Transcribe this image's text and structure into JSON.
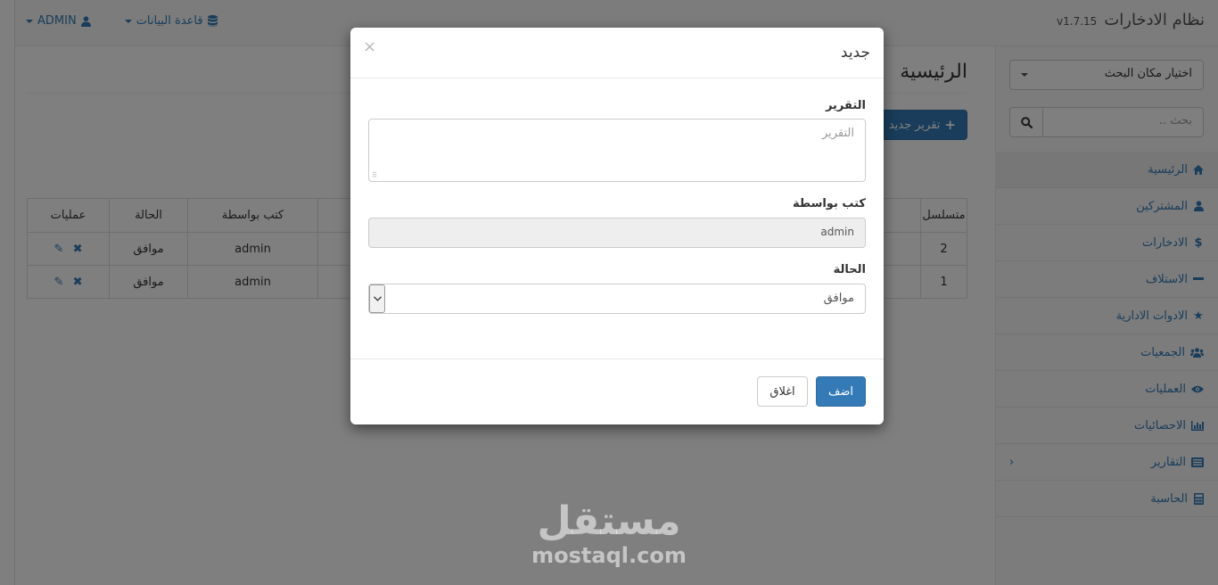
{
  "navbar": {
    "brand": "نظام الادخارات",
    "version": "v1.7.15",
    "database_label": "قاعدة البيانات",
    "user_label": "ADMIN"
  },
  "sidebar": {
    "location_select": "اختيار مكان البحث",
    "search_placeholder": "بحث ..",
    "items": [
      {
        "label": "الرئيسية",
        "icon": "home-icon"
      },
      {
        "label": "المشتركين",
        "icon": "user-icon"
      },
      {
        "label": "الادخارات",
        "icon": "dollar-icon"
      },
      {
        "label": "الاستلاف",
        "icon": "minus-icon"
      },
      {
        "label": "الادوات الادارية",
        "icon": "star-icon"
      },
      {
        "label": "الجمعيات",
        "icon": "users-icon"
      },
      {
        "label": "العمليات",
        "icon": "eye-icon"
      },
      {
        "label": "الاحصائيات",
        "icon": "bar-chart-icon"
      },
      {
        "label": "التقارير",
        "icon": "list-icon"
      },
      {
        "label": "الحاسبة",
        "icon": "calculator-icon"
      }
    ]
  },
  "main": {
    "title": "الرئيسية",
    "new_report_button": "تقرير جديد",
    "table": {
      "headers": [
        "متسلسل",
        "",
        "كتب بواسطة",
        "الحالة",
        "عمليات"
      ],
      "rows": [
        {
          "serial": "2",
          "author": "admin",
          "status": "موافق"
        },
        {
          "serial": "1",
          "author": "admin",
          "status": "موافق"
        }
      ]
    }
  },
  "modal": {
    "title": "جديد",
    "close_symbol": "×",
    "report_label": "التقرير",
    "report_placeholder": "التقرير",
    "written_by_label": "كتب بواسطة",
    "written_by_value": "admin",
    "status_label": "الحالة",
    "status_value": "موافق",
    "add_button": "اضف",
    "close_button": "اغلاق"
  },
  "watermark": {
    "arabic": "مستقل",
    "latin": "mostaql.com"
  },
  "colors": {
    "primary": "#337ab7",
    "backdrop": "rgba(0,0,0,0.5)"
  }
}
